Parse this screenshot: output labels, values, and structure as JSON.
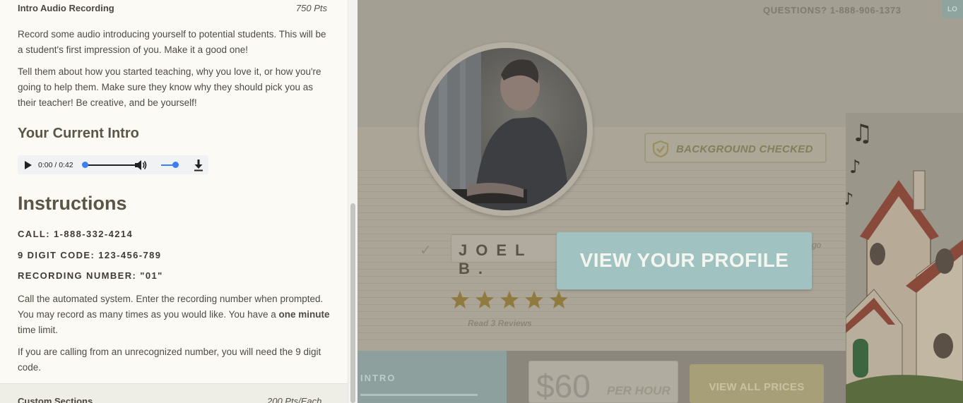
{
  "left_panel": {
    "section_title": "Intro Audio Recording",
    "section_points": "750 Pts",
    "para1": "Record some audio introducing yourself to potential students. This will be a student's first impression of you. Make it a good one!",
    "para2": "Tell them about how you started teaching, why you love it, or how you're going to help them. Make sure they know why they should pick you as their teacher! Be creative, and be yourself!",
    "current_intro_heading": "Your Current Intro",
    "audio": {
      "time": "0:00 / 0:42",
      "progress": 0.0,
      "volume": 1.0
    },
    "instructions_heading": "Instructions",
    "call": "CALL: 1-888-332-4214",
    "digit_code": "9 DIGIT CODE: 123-456-789",
    "recording_number": "RECORDING NUMBER: \"01\"",
    "para3_a": "Call the automated system. Enter the recording number when prompted. You may record as many times as you would like. You have a ",
    "para3_bold": "one minute",
    "para3_b": " time limit.",
    "para4": "If you are calling from an unrecognized number, you will need the 9 digit code.",
    "next_section_title": "Custom Sections",
    "next_section_points": "200 Pts/Each"
  },
  "profile_preview": {
    "questions": "QUESTIONS? 1-888-906-1373",
    "login_label": "LO",
    "background_checked": "BACKGROUND CHECKED",
    "name": "JOEL B.",
    "location_fragment": "go",
    "view_profile_button": "VIEW YOUR PROFILE",
    "rating": 5,
    "reviews": "Read 3 Reviews",
    "intro_tab": "INTRO",
    "price": "$60",
    "per_hour": "PER HOUR",
    "view_all_prices": "VIEW ALL PRICES"
  },
  "colors": {
    "overlay": "#a39f92",
    "cta": "#a0c3c2",
    "audio_accent": "#3d7ef0",
    "star": "#8f7a3f"
  }
}
